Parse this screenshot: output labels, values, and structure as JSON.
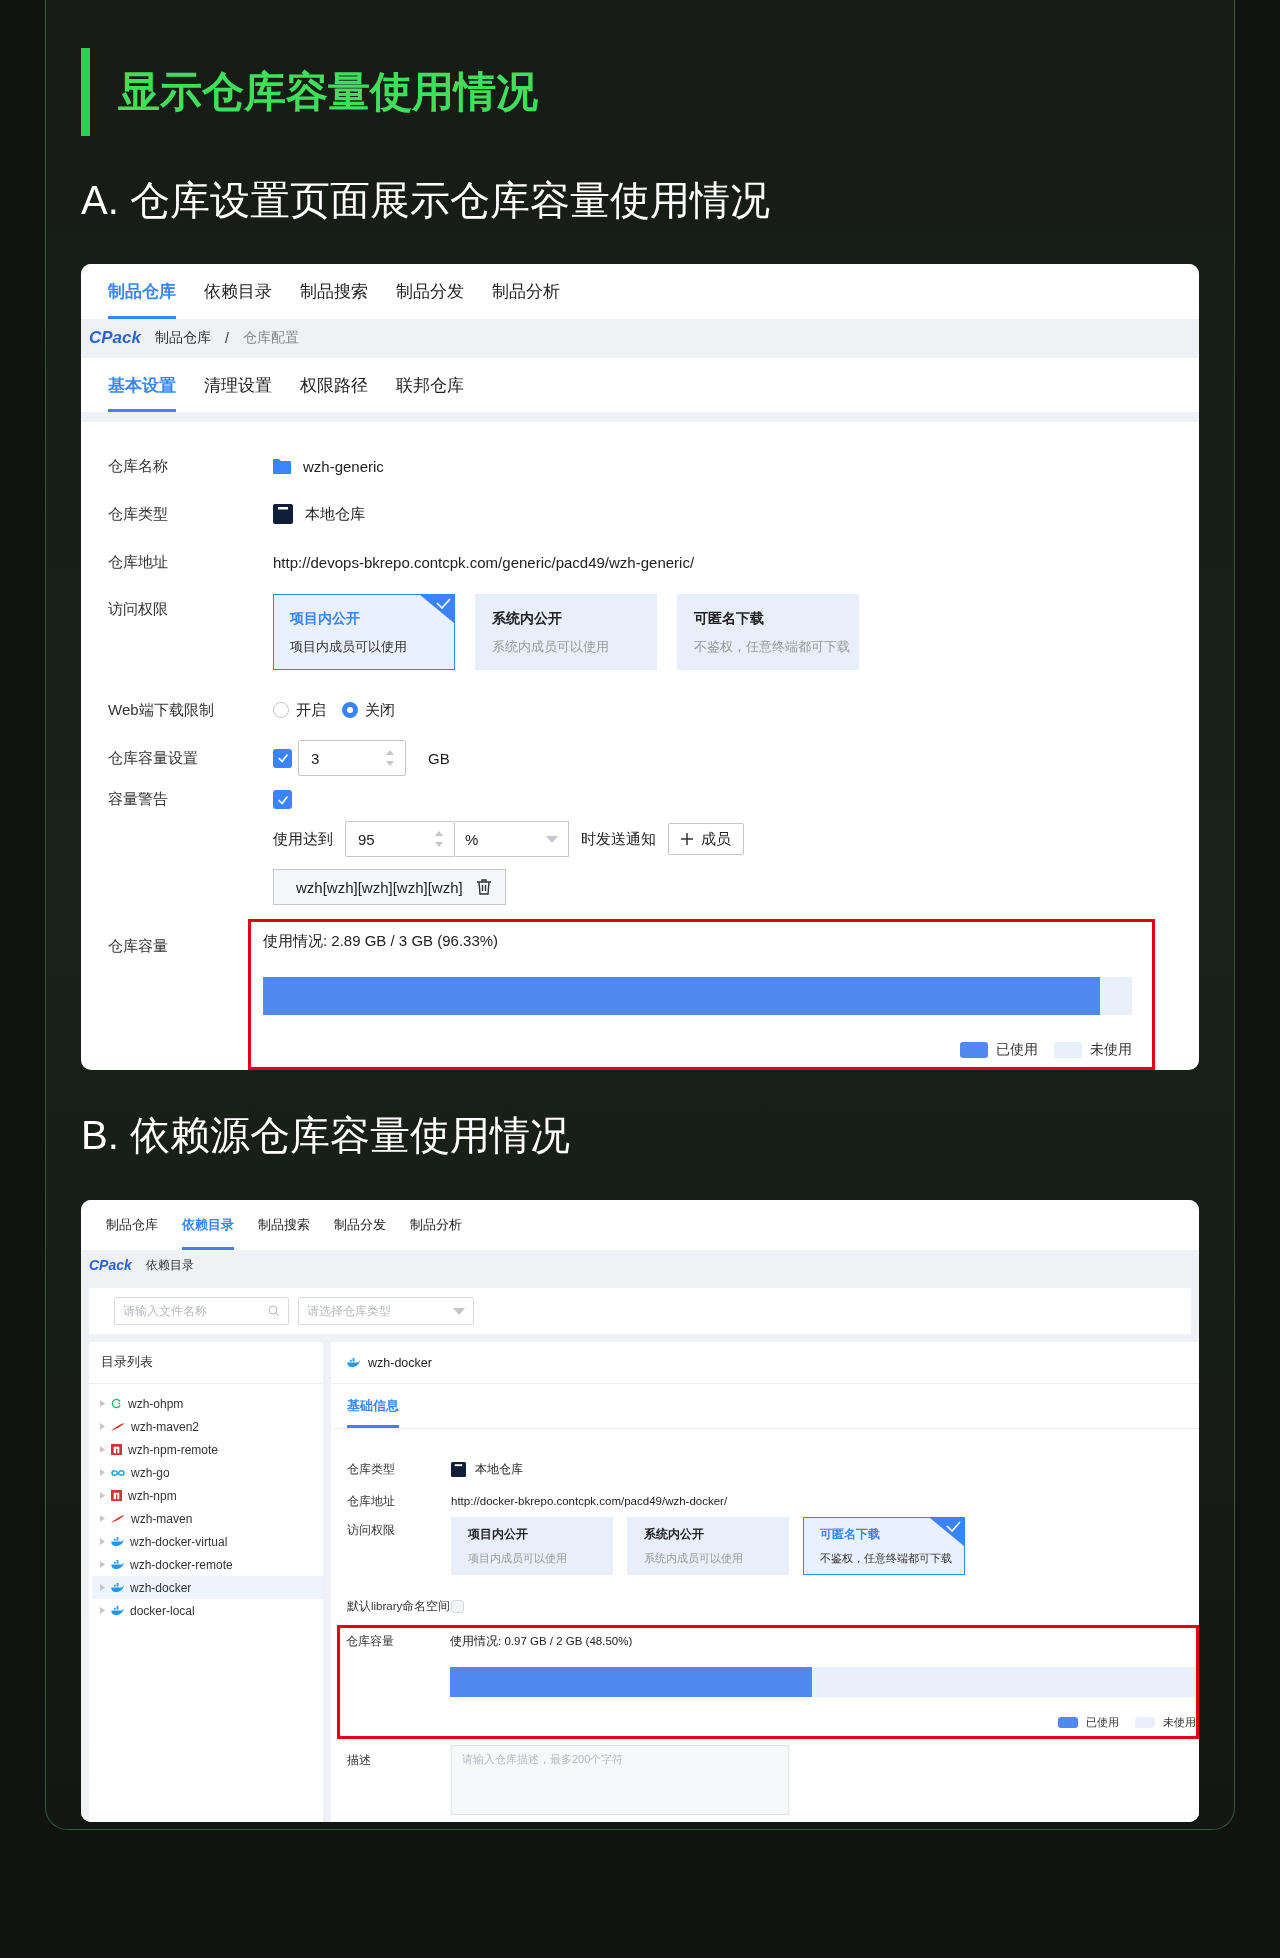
{
  "heading": "显示仓库容量使用情况",
  "section_a": {
    "title": "A. 仓库设置页面展示仓库容量使用情况",
    "nav_tabs": [
      {
        "label": "制品仓库",
        "selected": true
      },
      {
        "label": "依赖目录",
        "selected": false
      },
      {
        "label": "制品搜索",
        "selected": false
      },
      {
        "label": "制品分发",
        "selected": false
      },
      {
        "label": "制品分析",
        "selected": false
      }
    ],
    "breadcrumb": {
      "logo": "CPack",
      "items": [
        "制品仓库",
        "/",
        "仓库配置"
      ]
    },
    "sub_tabs": [
      {
        "label": "基本设置",
        "selected": true
      },
      {
        "label": "清理设置",
        "selected": false
      },
      {
        "label": "权限路径",
        "selected": false
      },
      {
        "label": "联邦仓库",
        "selected": false
      }
    ],
    "name": {
      "label": "仓库名称",
      "value": "wzh-generic"
    },
    "type": {
      "label": "仓库类型",
      "value": "本地仓库"
    },
    "address": {
      "label": "仓库地址",
      "value": "http://devops-bkrepo.contcpk.com/generic/pacd49/wzh-generic/"
    },
    "access": {
      "label": "访问权限",
      "options": [
        {
          "title": "项目内公开",
          "description": "项目内成员可以使用",
          "selected": true
        },
        {
          "title": "系统内公开",
          "description": "系统内成员可以使用",
          "selected": false
        },
        {
          "title": "可匿名下载",
          "description": "不鉴权，任意终端都可下载",
          "selected": false
        }
      ]
    },
    "web_download": {
      "label": "Web端下载限制",
      "options": [
        {
          "label": "开启",
          "selected": false
        },
        {
          "label": "关闭",
          "selected": true
        }
      ]
    },
    "capacity_setting": {
      "label": "仓库容量设置",
      "checked": true,
      "value": "3",
      "unit": "GB"
    },
    "capacity_warning": {
      "label": "容量警告",
      "checked": true,
      "prefix": "使用达到",
      "value": "95",
      "unit": "%",
      "suffix": "时发送通知",
      "add_button": "成员",
      "member": "wzh[wzh][wzh][wzh][wzh]"
    },
    "capacity": {
      "label": "仓库容量",
      "usage": "使用情况: 2.89 GB / 3 GB (96.33%)",
      "level": 0.9633,
      "legend_used": "已使用",
      "legend_unused": "未使用"
    }
  },
  "section_b": {
    "title": "B. 依赖源仓库容量使用情况",
    "nav_tabs": [
      {
        "label": "制品仓库",
        "selected": false
      },
      {
        "label": "依赖目录",
        "selected": true
      },
      {
        "label": "制品搜索",
        "selected": false
      },
      {
        "label": "制品分发",
        "selected": false
      },
      {
        "label": "制品分析",
        "selected": false
      }
    ],
    "breadcrumb": {
      "logo": "CPack",
      "items": [
        "依赖目录"
      ]
    },
    "search": {
      "placeholder": "请输入文件名称"
    },
    "type_select": {
      "placeholder": "请选择仓库类型"
    },
    "tree_title": "目录列表",
    "tree": [
      {
        "label": "wzh-ohpm",
        "kind": "ohpm",
        "selected": false
      },
      {
        "label": "wzh-maven2",
        "kind": "maven",
        "selected": false
      },
      {
        "label": "wzh-npm-remote",
        "kind": "npm",
        "selected": false
      },
      {
        "label": "wzh-go",
        "kind": "go",
        "selected": false
      },
      {
        "label": "wzh-npm",
        "kind": "npm",
        "selected": false
      },
      {
        "label": "wzh-maven",
        "kind": "maven",
        "selected": false
      },
      {
        "label": "wzh-docker-virtual",
        "kind": "docker",
        "selected": false
      },
      {
        "label": "wzh-docker-remote",
        "kind": "docker",
        "selected": false
      },
      {
        "label": "wzh-docker",
        "kind": "docker",
        "selected": true
      },
      {
        "label": "docker-local",
        "kind": "docker",
        "selected": false
      }
    ],
    "repo_title": "wzh-docker",
    "detail_tabs": [
      {
        "label": "基础信息",
        "selected": true
      }
    ],
    "type": {
      "label": "仓库类型",
      "value": "本地仓库"
    },
    "address": {
      "label": "仓库地址",
      "value": "http://docker-bkrepo.contcpk.com/pacd49/wzh-docker/"
    },
    "access": {
      "label": "访问权限",
      "options": [
        {
          "title": "项目内公开",
          "description": "项目内成员可以使用",
          "selected": false
        },
        {
          "title": "系统内公开",
          "description": "系统内成员可以使用",
          "selected": false
        },
        {
          "title": "可匿名下载",
          "description": "不鉴权，任意终端都可下载",
          "selected": true
        }
      ]
    },
    "library_namespace": {
      "label": "默认library命名空间",
      "checked": false
    },
    "capacity": {
      "label": "仓库容量",
      "usage": "使用情况: 0.97 GB / 2 GB (48.50%)",
      "level": 0.485,
      "legend_used": "已使用",
      "legend_unused": "未使用"
    },
    "description": {
      "label": "描述",
      "placeholder": "请输入仓库描述，最多200个字符"
    }
  }
}
